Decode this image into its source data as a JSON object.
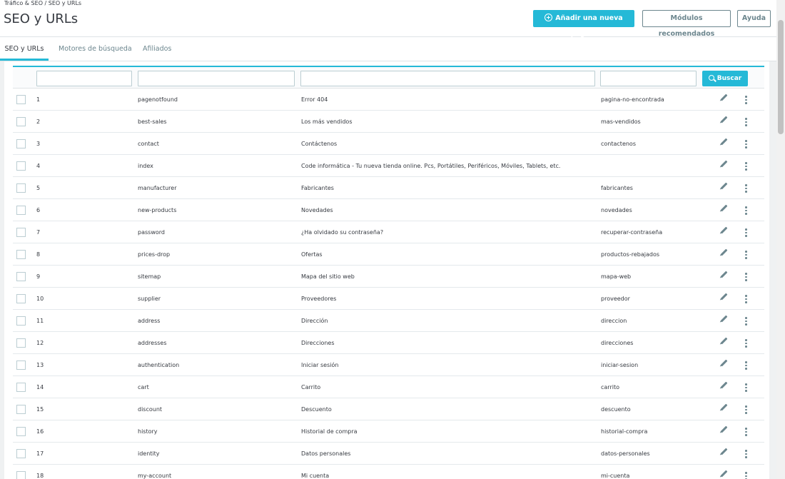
{
  "breadcrumb": {
    "parent": "Tráfico & SEO",
    "separator": "/",
    "current": "SEO y URLs"
  },
  "page_title": "SEO y URLs",
  "toolbar": {
    "add_label": "Añadir una nueva página",
    "modules_label": "Módulos recomendados",
    "help_label": "Ayuda"
  },
  "tabs": [
    {
      "label": "SEO y URLs",
      "active": true
    },
    {
      "label": "Motores de búsqueda",
      "active": false
    },
    {
      "label": "Afiliados",
      "active": false
    }
  ],
  "filters": {
    "search_label": "Buscar"
  },
  "rows": [
    {
      "id": "1",
      "page": "pagenotfound",
      "title": "Error 404",
      "url": "pagina-no-encontrada"
    },
    {
      "id": "2",
      "page": "best-sales",
      "title": "Los más vendidos",
      "url": "mas-vendidos"
    },
    {
      "id": "3",
      "page": "contact",
      "title": "Contáctenos",
      "url": "contactenos"
    },
    {
      "id": "4",
      "page": "index",
      "title": "Code informática - Tu nueva tienda online. Pcs, Portátiles, Periféricos, Móviles, Tablets, etc.",
      "url": ""
    },
    {
      "id": "5",
      "page": "manufacturer",
      "title": "Fabricantes",
      "url": "fabricantes"
    },
    {
      "id": "6",
      "page": "new-products",
      "title": "Novedades",
      "url": "novedades"
    },
    {
      "id": "7",
      "page": "password",
      "title": "¿Ha olvidado su contraseña?",
      "url": "recuperar-contraseña"
    },
    {
      "id": "8",
      "page": "prices-drop",
      "title": "Ofertas",
      "url": "productos-rebajados"
    },
    {
      "id": "9",
      "page": "sitemap",
      "title": "Mapa del sitio web",
      "url": "mapa-web"
    },
    {
      "id": "10",
      "page": "supplier",
      "title": "Proveedores",
      "url": "proveedor"
    },
    {
      "id": "11",
      "page": "address",
      "title": "Dirección",
      "url": "direccion"
    },
    {
      "id": "12",
      "page": "addresses",
      "title": "Direcciones",
      "url": "direcciones"
    },
    {
      "id": "13",
      "page": "authentication",
      "title": "Iniciar sesión",
      "url": "iniciar-sesion"
    },
    {
      "id": "14",
      "page": "cart",
      "title": "Carrito",
      "url": "carrito"
    },
    {
      "id": "15",
      "page": "discount",
      "title": "Descuento",
      "url": "descuento"
    },
    {
      "id": "16",
      "page": "history",
      "title": "Historial de compra",
      "url": "historial-compra"
    },
    {
      "id": "17",
      "page": "identity",
      "title": "Datos personales",
      "url": "datos-personales"
    },
    {
      "id": "18",
      "page": "my-account",
      "title": "Mi cuenta",
      "url": "mi-cuenta"
    }
  ],
  "colors": {
    "accent": "#25b9d7",
    "text": "#363a41",
    "muted": "#6c868e"
  },
  "icons": {
    "add": "plus-circle-icon",
    "search": "search-icon",
    "edit": "pencil-icon",
    "more": "kebab-icon"
  }
}
